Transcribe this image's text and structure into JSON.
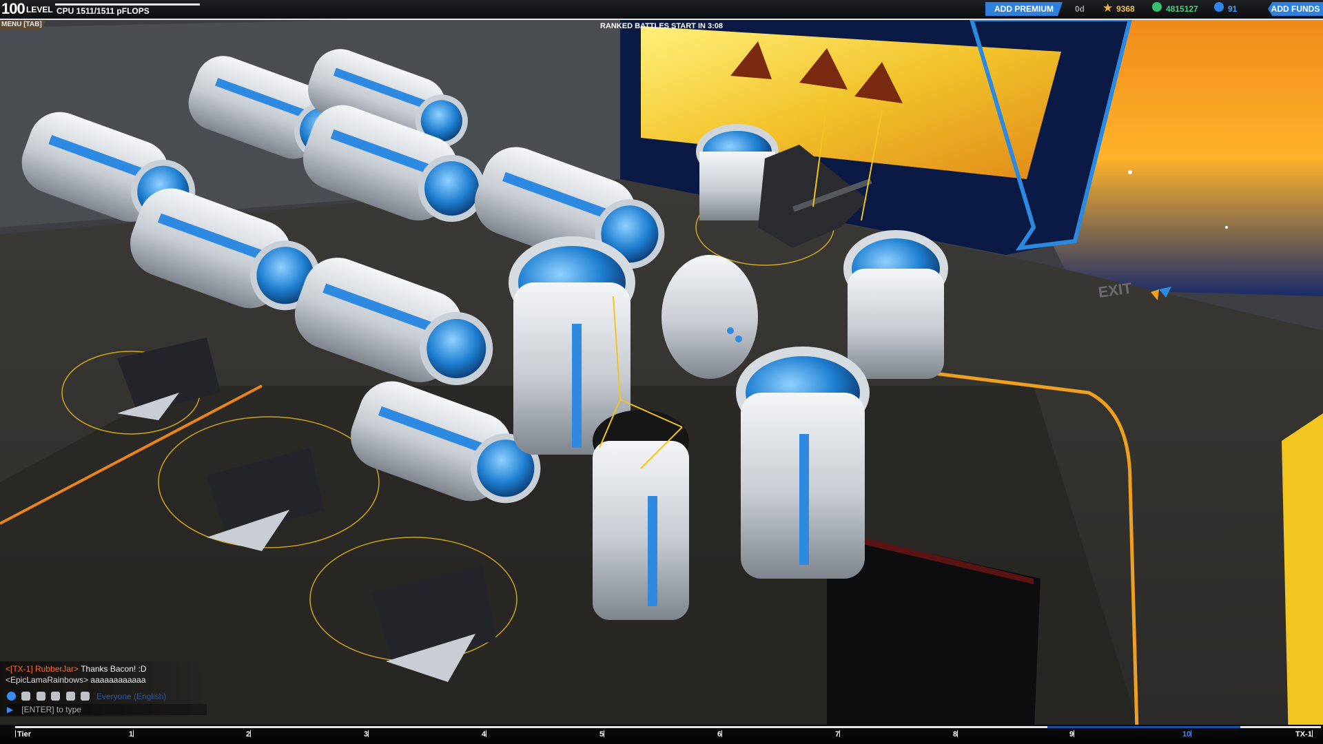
{
  "hud": {
    "level": "100",
    "level_label": "LEVEL",
    "cpu": "CPU 1511/1511 pFLOPS",
    "menu": "MENU [TAB]",
    "ranked": "RANKED BATTLES START IN 3:08",
    "add_premium": "ADD PREMIUM",
    "premium_days": "0d",
    "robits": "9368",
    "rp": "4815127",
    "cosmetic": "91",
    "add_funds": "ADD FUNDS",
    "exit_sign": "EXIT"
  },
  "chat": {
    "lines": [
      {
        "sender": "<[TX-1] RubberJar>",
        "message": "Thanks Bacon! :D"
      },
      {
        "sender": "<EpicLamaRainbows>",
        "message": "aaaaaaaaaaaa"
      }
    ],
    "channel": "Everyone (English)",
    "input_hint": "[ENTER] to type"
  },
  "tier": {
    "label": "Tier",
    "ticks": [
      "1",
      "2",
      "3",
      "4",
      "5",
      "6",
      "7",
      "8",
      "9",
      "10"
    ],
    "end_label": "TX-1"
  },
  "colors": {
    "accent_blue": "#2f7fdc",
    "robits": "#f6c24c",
    "rp": "#4fd07f",
    "cosmetic": "#47a2ff"
  }
}
